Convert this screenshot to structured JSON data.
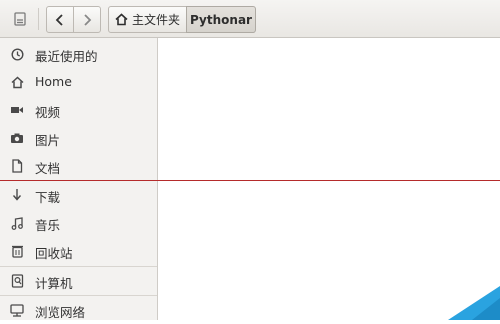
{
  "toolbar": {
    "menu_icon": "document-menu-icon",
    "back_icon": "chevron-left-icon",
    "forward_icon": "chevron-right-icon",
    "breadcrumb": {
      "home_icon": "home-icon",
      "home_label": "主文件夹",
      "current_label": "Pythonar"
    }
  },
  "sidebar": {
    "items": [
      {
        "label": "最近使用的",
        "icon": "clock-icon"
      },
      {
        "label": "Home",
        "icon": "home-icon"
      },
      {
        "label": "视频",
        "icon": "video-icon"
      },
      {
        "label": "图片",
        "icon": "camera-icon"
      },
      {
        "label": "文档",
        "icon": "document-icon"
      },
      {
        "label": "下载",
        "icon": "download-icon"
      },
      {
        "label": "音乐",
        "icon": "music-icon"
      },
      {
        "label": "回收站",
        "icon": "trash-icon"
      },
      {
        "label": "计算机",
        "icon": "computer-icon"
      },
      {
        "label": "浏览网络",
        "icon": "network-icon"
      }
    ]
  },
  "colors": {
    "toolbar_bg": "#ece9e5",
    "sidebar_bg": "#f3f2f0",
    "content_bg": "#ffffff",
    "annotation_line": "#b52b2b",
    "corner_accent": "#2aa3e0"
  }
}
